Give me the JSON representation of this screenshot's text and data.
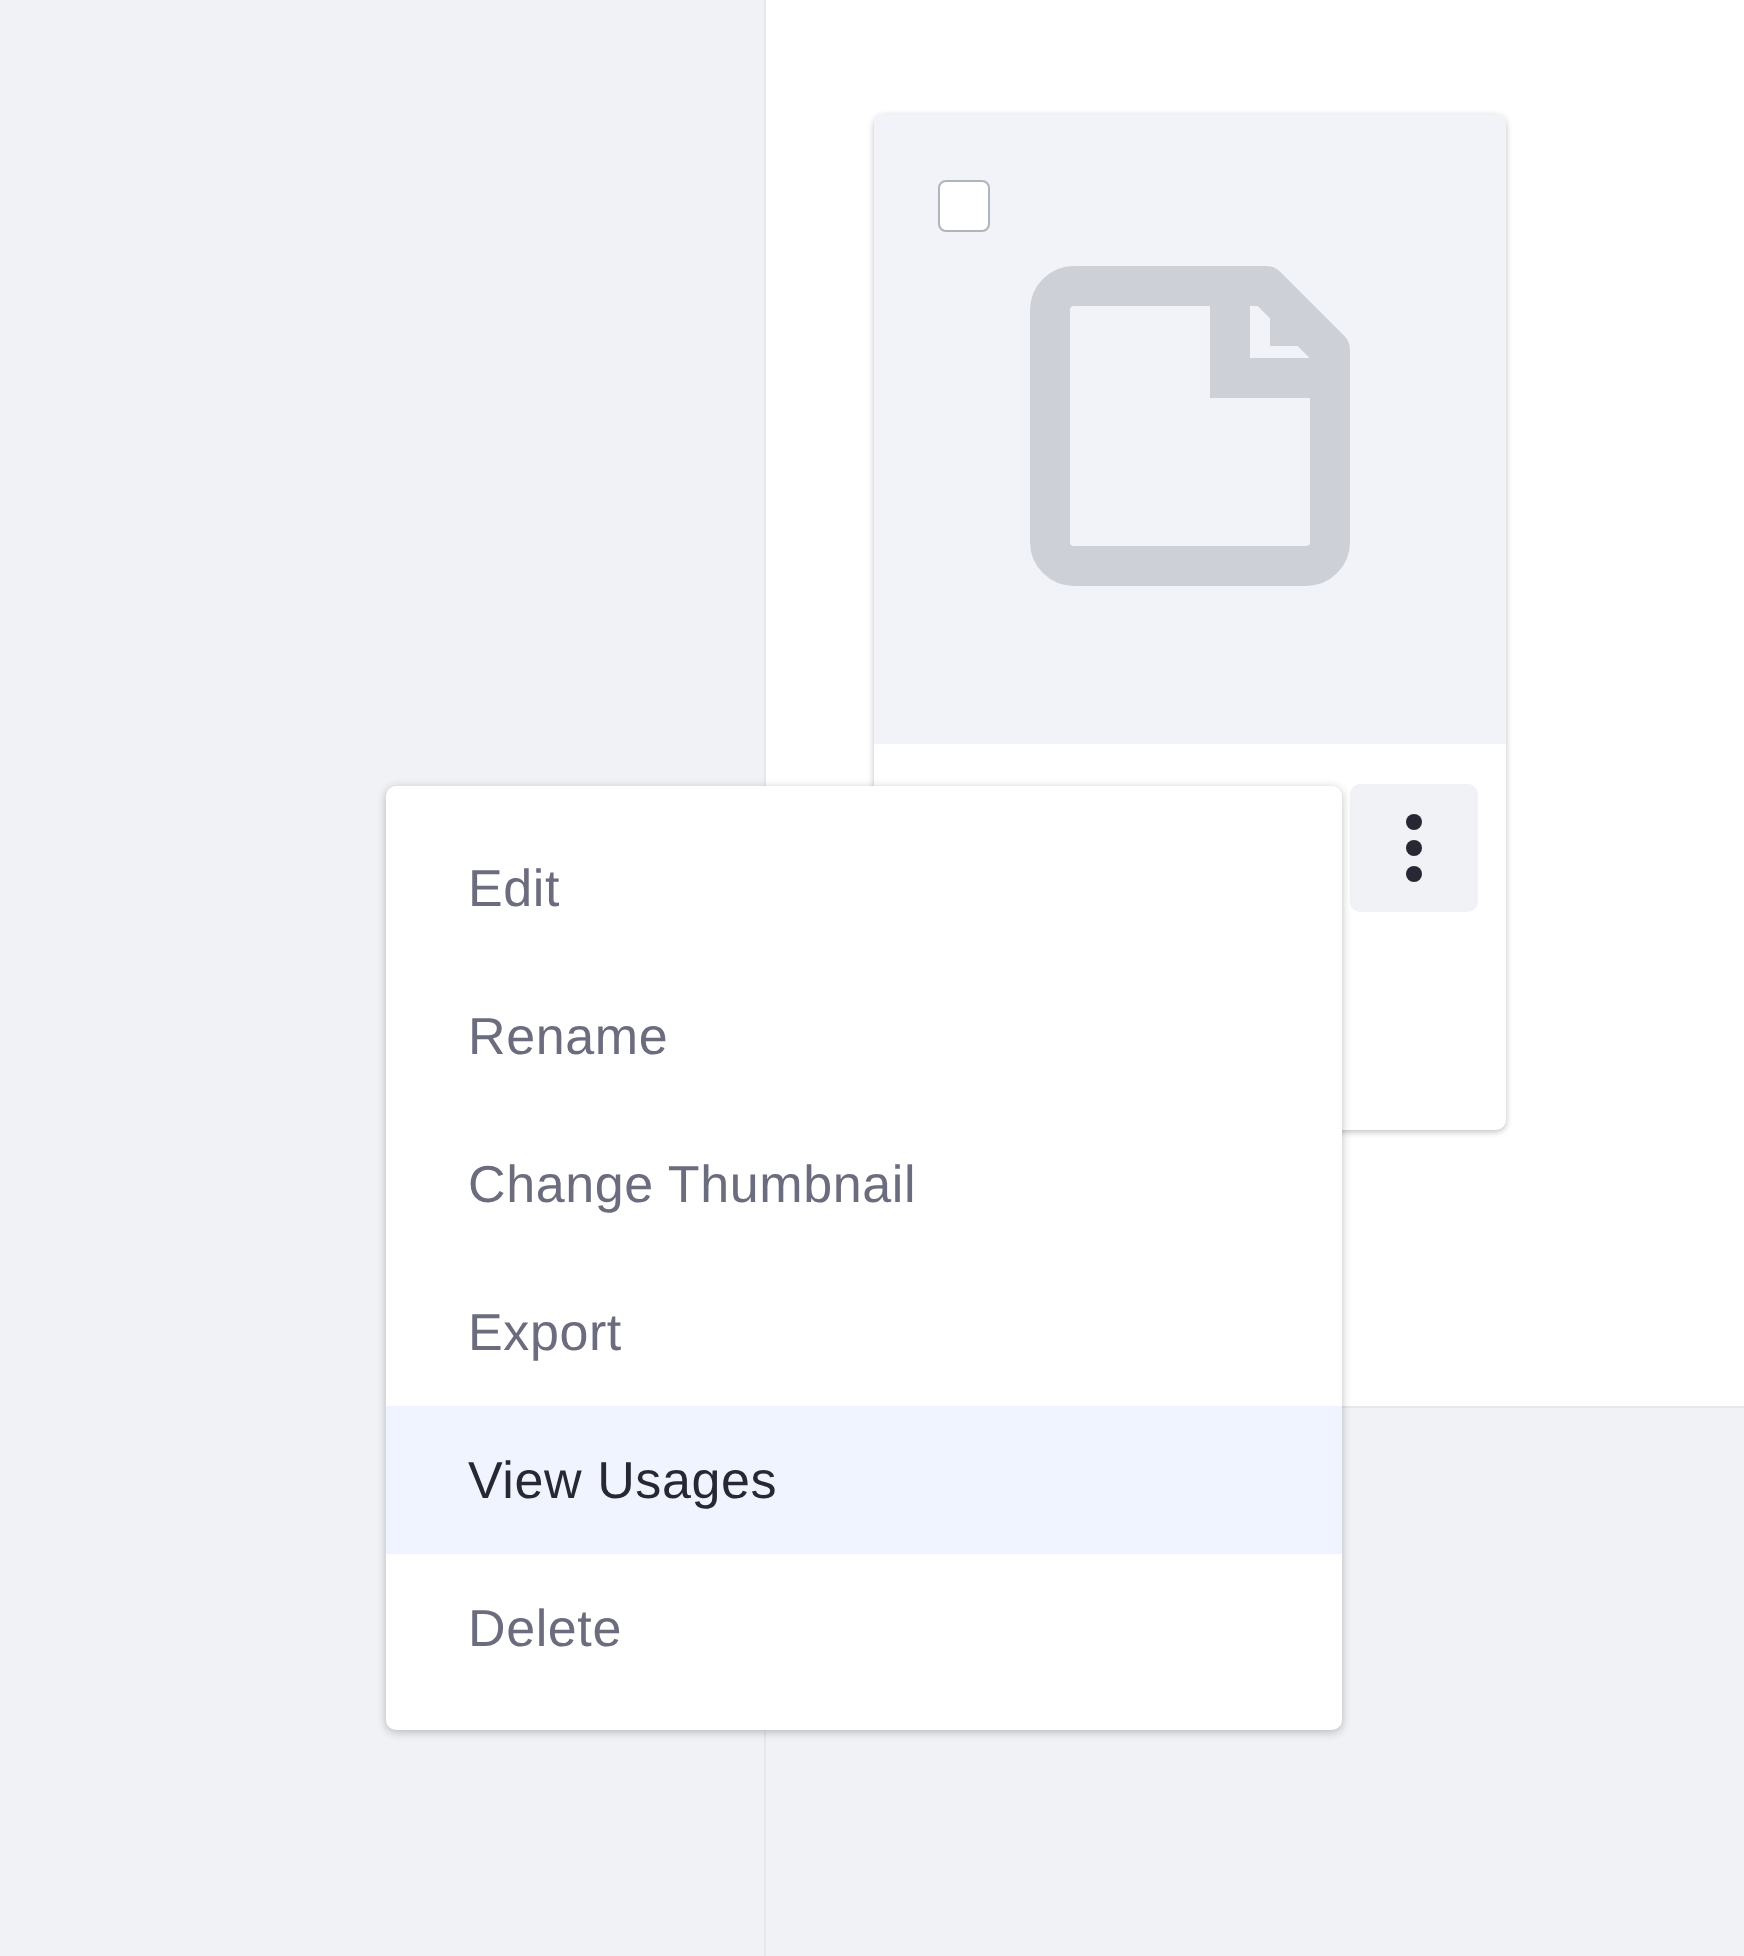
{
  "card": {
    "checkbox": {
      "checked": false
    }
  },
  "menu": {
    "items": [
      {
        "label": "Edit",
        "selected": false
      },
      {
        "label": "Rename",
        "selected": false
      },
      {
        "label": "Change Thumbnail",
        "selected": false
      },
      {
        "label": "Export",
        "selected": false
      },
      {
        "label": "View Usages",
        "selected": true
      },
      {
        "label": "Delete",
        "selected": false
      }
    ]
  }
}
